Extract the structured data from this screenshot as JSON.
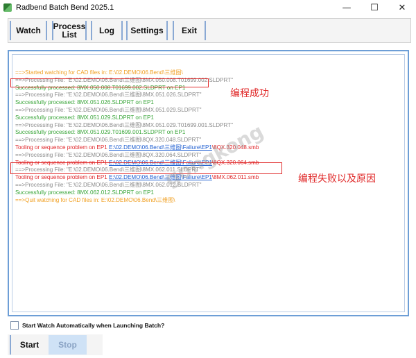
{
  "window": {
    "title": "Radbend Batch Bend 2025.1",
    "minimize": "—",
    "maximize": "☐",
    "close": "✕"
  },
  "toolbar": {
    "watch": "Watch",
    "process_line1": "Process",
    "process_line2": "List",
    "log": "Log",
    "settings": "Settings",
    "exit": "Exit"
  },
  "log": {
    "l1": "==>Started watching for CAD files in: E:\\02.DEMO\\06.Bend\\三维图\\",
    "l2": "==>Processing File: \"E:\\02.DEMO\\06.Bend\\三维图\\8MX.050.008.T01699.002.SLDPRT\"",
    "l3": "Successfully processed: 8MX.050.008.T01699.002.SLDPRT on EP1",
    "l4": "==>Processing File: \"E:\\02.DEMO\\06.Bend\\三维图\\8MX.051.026.SLDPRT\"",
    "l5": "Successfully processed: 8MX.051.026.SLDPRT on EP1",
    "l6": "==>Processing File: \"E:\\02.DEMO\\06.Bend\\三维图\\8MX.051.029.SLDPRT\"",
    "l7": "Successfully processed: 8MX.051.029.SLDPRT on EP1",
    "l8": "==>Processing File: \"E:\\02.DEMO\\06.Bend\\三维图\\8MX.051.029.T01699.001.SLDPRT\"",
    "l9": "Successfully processed: 8MX.051.029.T01699.001.SLDPRT on EP1",
    "l10": "==>Processing File: \"E:\\02.DEMO\\06.Bend\\三维图\\8QX.320.048.SLDPRT\"",
    "l11_prefix": "Tooling or sequence problem on EP1 ",
    "l11_link": "E:\\02.DEMO\\06.Bend\\三维图\\Faliure\\EP1",
    "l11_suffix": "\\8QX.320.048.smb",
    "l12": "==>Processing File: \"E:\\02.DEMO\\06.Bend\\三维图\\8QX.320.064.SLDPRT\"",
    "l13_prefix": "Tooling or sequence problem on EP1 ",
    "l13_link": "E:\\02.DEMO\\06.Bend\\三维图\\Faliure\\EP1",
    "l13_suffix": "\\8QX.320.064.smb",
    "l14": "==>Processing File: \"E:\\02.DEMO\\06.Bend\\三维图\\8MX.062.011.SLDPRT\"",
    "l15_prefix": "Tooling or sequence problem on EP1 ",
    "l15_link": "E:\\02.DEMO\\06.Bend\\三维图\\Faliure\\EP1",
    "l15_suffix": "\\8MX.062.011.smb",
    "l16": "==>Processing File: \"E:\\02.DEMO\\06.Bend\\三维图\\8MX.062.012.SLDPRT\"",
    "l17": "Successfully processed: 8MX.062.012.SLDPRT on EP1",
    "l18": "==>Quit watching for CAD files in: E:\\02.DEMO\\06.Bend\\三维图\\"
  },
  "annotations": {
    "success": "编程成功",
    "failure": "编程失败以及原因",
    "watermark": "gongkong"
  },
  "options": {
    "auto_watch_label": "Start Watch Automatically when Launching Batch?"
  },
  "buttons": {
    "start": "Start",
    "stop": "Stop"
  },
  "colors": {
    "info": "#f0a023",
    "processing": "#8a8a8a",
    "success": "#3aa63a",
    "error": "#e0262a",
    "link": "#1f5fd1",
    "annotation": "#e02a2a"
  }
}
